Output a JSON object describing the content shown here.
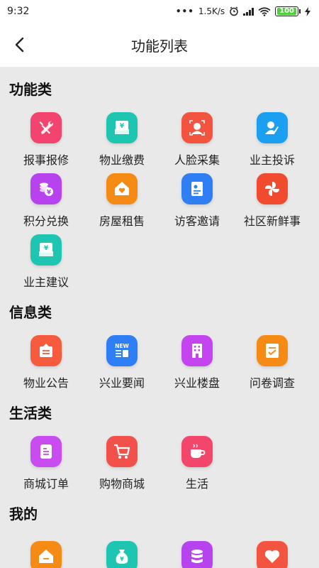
{
  "status_bar": {
    "time": "9:32",
    "network_speed": "1.5K/s",
    "battery": "100"
  },
  "nav": {
    "title": "功能列表"
  },
  "sections": [
    {
      "title": "功能类",
      "items": [
        {
          "label": "报事报修",
          "icon": "tools-icon",
          "color": "#f2446f"
        },
        {
          "label": "物业缴费",
          "icon": "payment-icon",
          "color": "#1ec5b0"
        },
        {
          "label": "人脸采集",
          "icon": "face-scan-icon",
          "color": "#f2543f"
        },
        {
          "label": "业主投诉",
          "icon": "user-edit-icon",
          "color": "#1b9ff0"
        },
        {
          "label": "积分兑换",
          "icon": "coins-icon",
          "color": "#b743ef"
        },
        {
          "label": "房屋租售",
          "icon": "house-heart-icon",
          "color": "#f58a15"
        },
        {
          "label": "访客邀请",
          "icon": "contact-card-icon",
          "color": "#2f7ef3"
        },
        {
          "label": "社区新鲜事",
          "icon": "pinwheel-icon",
          "color": "#f04a2f"
        },
        {
          "label": "业主建议",
          "icon": "suggestion-icon",
          "color": "#1ec5b0"
        }
      ]
    },
    {
      "title": "信息类",
      "items": [
        {
          "label": "物业公告",
          "icon": "notice-icon",
          "color": "#f55b3c"
        },
        {
          "label": "兴业要闻",
          "icon": "news-icon",
          "color": "#2e7ff5"
        },
        {
          "label": "兴业楼盘",
          "icon": "building-icon",
          "color": "#c445ef"
        },
        {
          "label": "问卷调查",
          "icon": "survey-icon",
          "color": "#f58a15"
        }
      ]
    },
    {
      "title": "生活类",
      "items": [
        {
          "label": "商城订单",
          "icon": "order-icon",
          "color": "#c94cf0"
        },
        {
          "label": "购物商城",
          "icon": "cart-icon",
          "color": "#f2504a"
        },
        {
          "label": "生活",
          "icon": "coffee-icon",
          "color": "#f2476b"
        }
      ]
    },
    {
      "title": "我的",
      "items": [
        {
          "label": "",
          "icon": "my-house-icon",
          "color": "#f58a15"
        },
        {
          "label": "",
          "icon": "money-bag-icon",
          "color": "#1ec5b0"
        },
        {
          "label": "",
          "icon": "database-icon",
          "color": "#b743ef"
        },
        {
          "label": "",
          "icon": "heart-icon",
          "color": "#f2543f"
        }
      ]
    }
  ]
}
